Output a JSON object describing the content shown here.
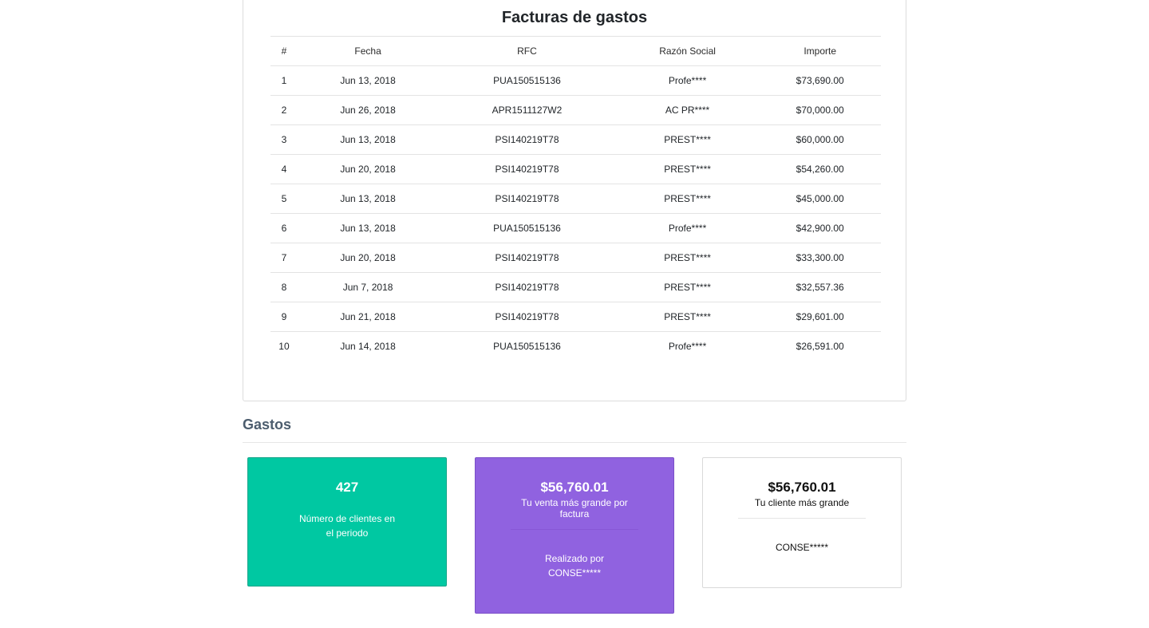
{
  "invoices": {
    "title": "Facturas de gastos",
    "columns": [
      "#",
      "Fecha",
      "RFC",
      "Razón Social",
      "Importe"
    ],
    "rows": [
      [
        "1",
        "Jun 13, 2018",
        "PUA150515136",
        "Profe****",
        "$73,690.00"
      ],
      [
        "2",
        "Jun 26, 2018",
        "APR1511127W2",
        "AC PR****",
        "$70,000.00"
      ],
      [
        "3",
        "Jun 13, 2018",
        "PSI140219T78",
        "PREST****",
        "$60,000.00"
      ],
      [
        "4",
        "Jun 20, 2018",
        "PSI140219T78",
        "PREST****",
        "$54,260.00"
      ],
      [
        "5",
        "Jun 13, 2018",
        "PSI140219T78",
        "PREST****",
        "$45,000.00"
      ],
      [
        "6",
        "Jun 13, 2018",
        "PUA150515136",
        "Profe****",
        "$42,900.00"
      ],
      [
        "7",
        "Jun 20, 2018",
        "PSI140219T78",
        "PREST****",
        "$33,300.00"
      ],
      [
        "8",
        "Jun 7, 2018",
        "PSI140219T78",
        "PREST****",
        "$32,557.36"
      ],
      [
        "9",
        "Jun 21, 2018",
        "PSI140219T78",
        "PREST****",
        "$29,601.00"
      ],
      [
        "10",
        "Jun 14, 2018",
        "PUA150515136",
        "Profe****",
        "$26,591.00"
      ]
    ]
  },
  "expenses": {
    "section_title": "Gastos",
    "clients_card": {
      "value": "427",
      "label": "Número de clientes en el periodo",
      "color": "#00c8a2"
    },
    "largest_sale_card": {
      "value": "$56,760.01",
      "label": "Tu venta más grande por factura",
      "sub": "Realizado por CONSE*****",
      "color": "#9062e0"
    },
    "largest_client_card": {
      "value": "$56,760.01",
      "label": "Tu cliente más grande",
      "sub": "CONSE*****"
    }
  }
}
